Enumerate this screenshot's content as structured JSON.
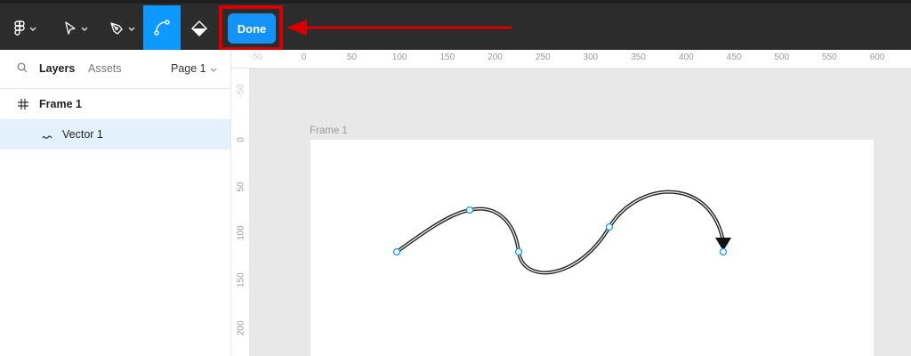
{
  "toolbar": {
    "tools": [
      {
        "name": "main-menu",
        "icon": "figma-logo-icon"
      },
      {
        "name": "move-tool",
        "icon": "arrow-cursor-icon"
      },
      {
        "name": "pen-tool",
        "icon": "pen-nib-icon"
      },
      {
        "name": "bend-tool",
        "icon": "bend-path-icon",
        "active": true
      },
      {
        "name": "paint-bucket-tool",
        "icon": "paint-bucket-icon"
      }
    ],
    "done_label": "Done",
    "accent": "#0d99ff",
    "highlight_color": "#d60000"
  },
  "panel": {
    "tab_layers": "Layers",
    "tab_assets": "Assets",
    "page_name": "Page 1",
    "layers": [
      {
        "label": "Frame 1",
        "icon": "frame-hash-icon"
      },
      {
        "label": "Vector 1",
        "icon": "vector-path-icon",
        "selected": true
      }
    ]
  },
  "ruler": {
    "top_labels": [
      "-50",
      "0",
      "50",
      "100",
      "150",
      "200",
      "250",
      "300",
      "350",
      "400",
      "450",
      "500",
      "550",
      "600"
    ],
    "left_labels": [
      "-50",
      "0",
      "50",
      "100",
      "150",
      "200"
    ]
  },
  "canvas": {
    "frame_label": "Frame 1",
    "vector_points": 5,
    "end_cap": "arrow"
  }
}
